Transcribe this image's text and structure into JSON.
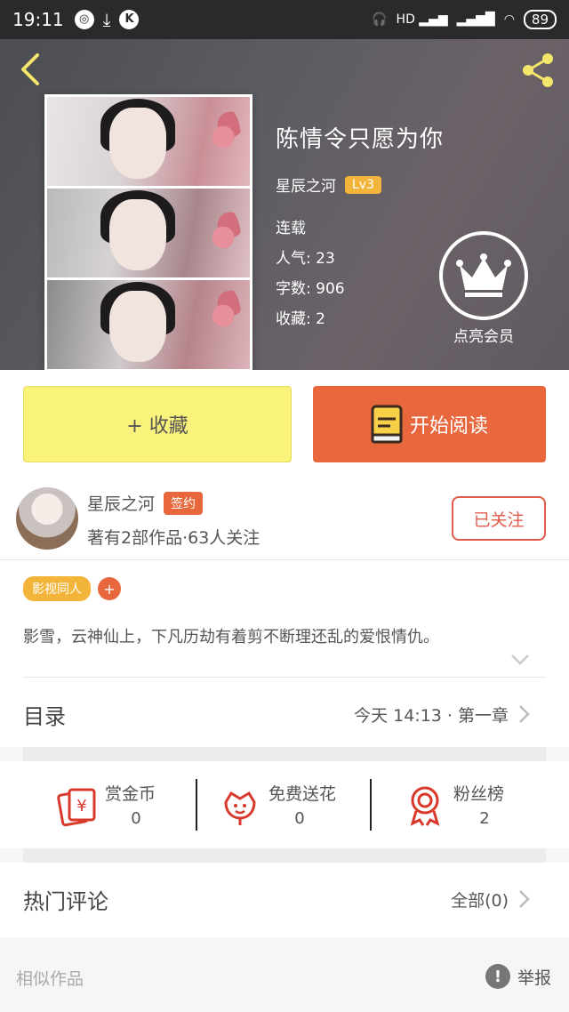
{
  "status_bar": {
    "time": "19:11",
    "battery": "89",
    "network": "HD"
  },
  "book": {
    "title": "陈情令只愿为你",
    "author": "星辰之河",
    "level": "Lv3",
    "status": "连载",
    "popularity": "人气: 23",
    "word_count": "字数: 906",
    "favorites": "收藏: 2"
  },
  "vip": {
    "label": "点亮会员"
  },
  "actions": {
    "collect_label": "+ 收藏",
    "read_label": "开始阅读"
  },
  "author": {
    "name": "星辰之河",
    "badge": "签约",
    "stats": "著有2部作品·63人关注",
    "follow_label": "已关注"
  },
  "tags": {
    "items": [
      "影视同人"
    ],
    "add_label": "+"
  },
  "description": "影雪，云神仙上，下凡历劫有着剪不断理还乱的爱恨情仇。",
  "catalog": {
    "label": "目录",
    "latest": "今天 14:13 · 第一章"
  },
  "stats": {
    "coins_label": "赏金币",
    "coins_value": "0",
    "flowers_label": "免费送花",
    "flowers_value": "0",
    "fans_label": "粉丝榜",
    "fans_value": "2"
  },
  "comments": {
    "label": "热门评论",
    "all_label": "全部(0)"
  },
  "footer": {
    "similar_label": "相似作品",
    "report_label": "举报"
  },
  "colors": {
    "accent_orange": "#e8673c",
    "collect_yellow": "#f9f27b",
    "tag_yellow": "#f2b53a",
    "follow_red": "#e15a4a"
  }
}
